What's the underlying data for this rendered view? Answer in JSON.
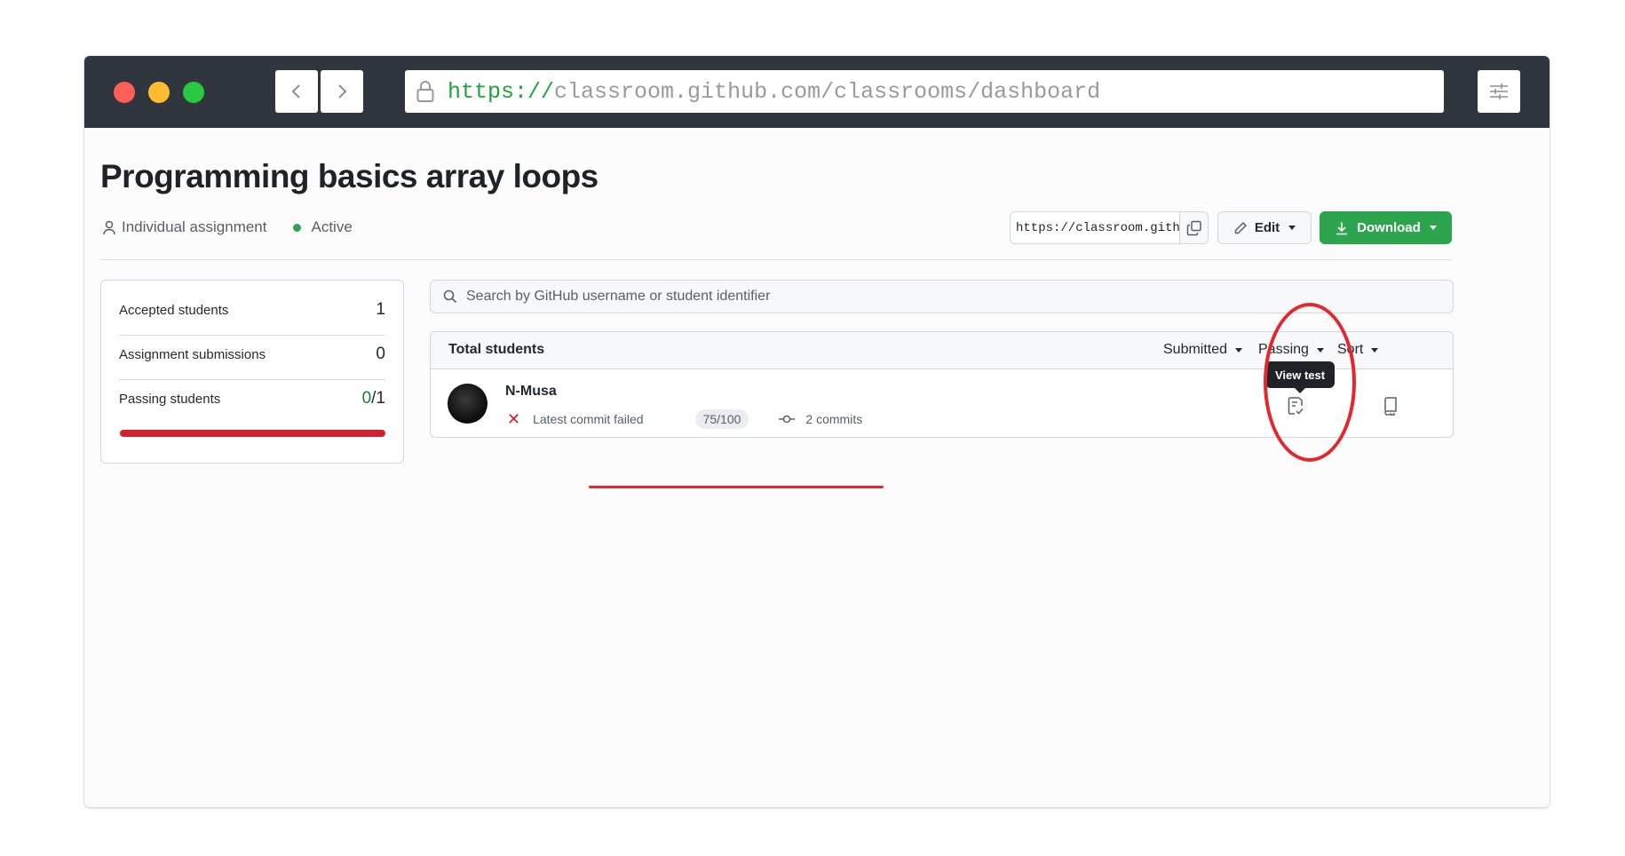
{
  "browser": {
    "url_scheme": "https://",
    "url_rest": "classroom.github.com/classrooms/dashboard"
  },
  "assignment": {
    "title": "Programming basics array loops",
    "type_label": "Individual assignment",
    "status_label": "Active",
    "invite_url": "https://classroom.github.com",
    "edit_label": "Edit",
    "download_label": "Download"
  },
  "stats": {
    "accepted_label": "Accepted students",
    "accepted_value": "1",
    "submissions_label": "Assignment submissions",
    "submissions_value": "0",
    "passing_label": "Passing students",
    "passing_value": "0",
    "passing_total": "/1",
    "passing_fraction": 0
  },
  "search": {
    "placeholder": "Search by GitHub username or student identifier"
  },
  "table": {
    "title": "Total students",
    "filters": [
      "Submitted",
      "Passing",
      "Sort"
    ],
    "rows": [
      {
        "name": "N-Musa",
        "status": "Latest commit failed",
        "score": "75/100",
        "commits": "2 commits"
      }
    ],
    "tooltip": "View test"
  },
  "icons": [
    "lock-icon",
    "chevron-left-icon",
    "chevron-right-icon",
    "sliders-icon",
    "person-icon",
    "copy-icon",
    "pencil-icon",
    "download-icon",
    "search-icon",
    "x-icon",
    "commit-icon",
    "file-check-icon",
    "repo-icon"
  ],
  "colors": {
    "titlebar": "#2f363d",
    "primary_green": "#2da44e",
    "danger_red": "#cf222e",
    "annotation_red": "#e5262c"
  }
}
